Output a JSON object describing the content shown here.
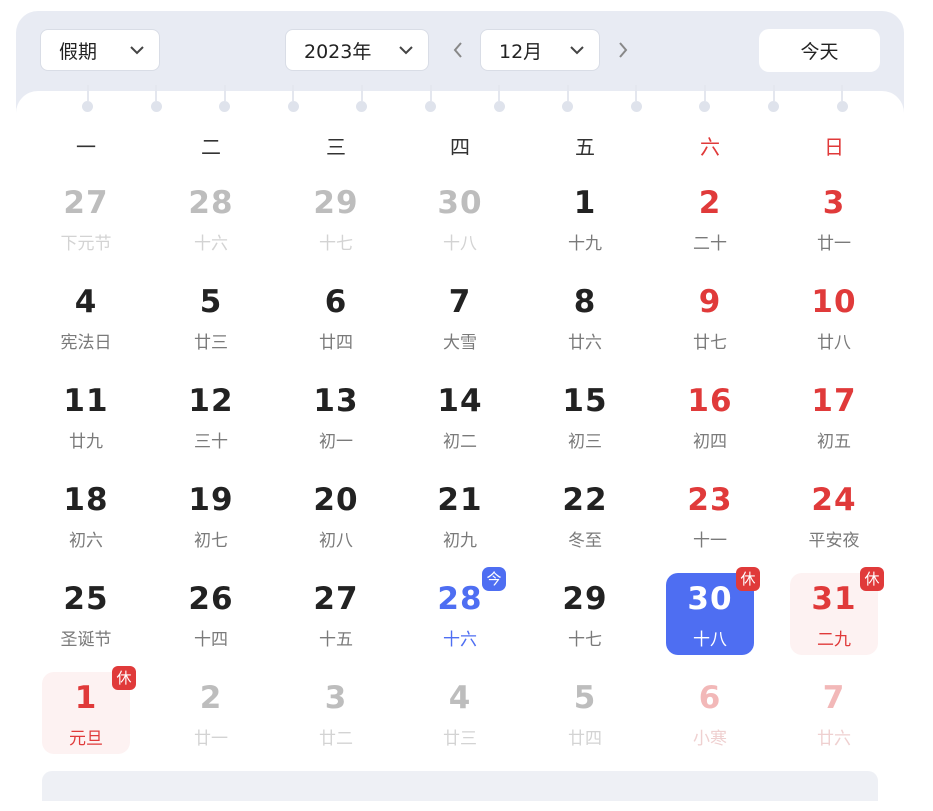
{
  "toolbar": {
    "holiday_select": "假期",
    "year_select": "2023年",
    "month_select": "12月",
    "today_button": "今天",
    "icons": [
      "chevron-down-icon",
      "chevron-left-icon",
      "chevron-right-icon"
    ]
  },
  "weekdays": [
    "一",
    "二",
    "三",
    "四",
    "五",
    "六",
    "日"
  ],
  "colors": {
    "accent": "#4e6ef2",
    "weekend": "#e03a3a",
    "holiday_bg": "#fdf2f2",
    "toolbar_bg": "#e8ebf3"
  },
  "weeks": [
    [
      {
        "day": "27",
        "lunar": "下元节",
        "dim": true
      },
      {
        "day": "28",
        "lunar": "十六",
        "dim": true
      },
      {
        "day": "29",
        "lunar": "十七",
        "dim": true
      },
      {
        "day": "30",
        "lunar": "十八",
        "dim": true
      },
      {
        "day": "1",
        "lunar": "十九"
      },
      {
        "day": "2",
        "lunar": "二十",
        "weekend": true
      },
      {
        "day": "3",
        "lunar": "廿一",
        "weekend": true
      }
    ],
    [
      {
        "day": "4",
        "lunar": "宪法日"
      },
      {
        "day": "5",
        "lunar": "廿三"
      },
      {
        "day": "6",
        "lunar": "廿四"
      },
      {
        "day": "7",
        "lunar": "大雪"
      },
      {
        "day": "8",
        "lunar": "廿六"
      },
      {
        "day": "9",
        "lunar": "廿七",
        "weekend": true
      },
      {
        "day": "10",
        "lunar": "廿八",
        "weekend": true
      }
    ],
    [
      {
        "day": "11",
        "lunar": "廿九"
      },
      {
        "day": "12",
        "lunar": "三十"
      },
      {
        "day": "13",
        "lunar": "初一"
      },
      {
        "day": "14",
        "lunar": "初二"
      },
      {
        "day": "15",
        "lunar": "初三"
      },
      {
        "day": "16",
        "lunar": "初四",
        "weekend": true
      },
      {
        "day": "17",
        "lunar": "初五",
        "weekend": true
      }
    ],
    [
      {
        "day": "18",
        "lunar": "初六"
      },
      {
        "day": "19",
        "lunar": "初七"
      },
      {
        "day": "20",
        "lunar": "初八"
      },
      {
        "day": "21",
        "lunar": "初九"
      },
      {
        "day": "22",
        "lunar": "冬至"
      },
      {
        "day": "23",
        "lunar": "十一",
        "weekend": true
      },
      {
        "day": "24",
        "lunar": "平安夜",
        "weekend": true
      }
    ],
    [
      {
        "day": "25",
        "lunar": "圣诞节"
      },
      {
        "day": "26",
        "lunar": "十四"
      },
      {
        "day": "27",
        "lunar": "十五"
      },
      {
        "day": "28",
        "lunar": "十六",
        "today": true,
        "badge": "今"
      },
      {
        "day": "29",
        "lunar": "十七"
      },
      {
        "day": "30",
        "lunar": "十八",
        "selected": true,
        "badge": "休"
      },
      {
        "day": "31",
        "lunar": "二九",
        "holiday": true,
        "badge": "休"
      }
    ],
    [
      {
        "day": "1",
        "lunar": "元旦",
        "holiday": true,
        "badge": "休"
      },
      {
        "day": "2",
        "lunar": "廿一",
        "dim": true
      },
      {
        "day": "3",
        "lunar": "廿二",
        "dim": true
      },
      {
        "day": "4",
        "lunar": "廿三",
        "dim": true
      },
      {
        "day": "5",
        "lunar": "廿四",
        "dim": true
      },
      {
        "day": "6",
        "lunar": "小寒",
        "dim": true,
        "weekend": true
      },
      {
        "day": "7",
        "lunar": "廿六",
        "dim": true,
        "weekend": true
      }
    ]
  ]
}
